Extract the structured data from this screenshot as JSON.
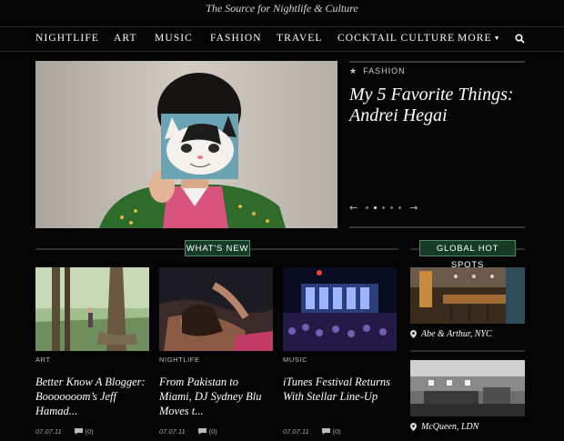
{
  "header": {
    "tagline": "The Source for Nightlife & Culture"
  },
  "nav": {
    "items": [
      "NIGHTLIFE",
      "ART",
      "MUSIC",
      "FASHION",
      "TRAVEL",
      "COCKTAIL CULTURE",
      "MORE"
    ],
    "search_icon": "search-icon"
  },
  "hero": {
    "category": "FASHION",
    "star": "★",
    "title": "My 5 Favorite Things: Andrei Hegai",
    "prev_arrow": "←",
    "next_arrow": "→",
    "slide_count": 5,
    "active_slide": 1
  },
  "sections": {
    "whats_new": "WHAT'S NEW",
    "hot_spots": "GLOBAL HOT SPOTS"
  },
  "articles": [
    {
      "category": "ART",
      "title": "Better Know A Blogger: Booooooom’s Jeff Hamad...",
      "date": "07.07.11",
      "comments": "(0)"
    },
    {
      "category": "NIGHTLIFE",
      "title": "From Pakistan to Miami, DJ Sydney Blu Moves t...",
      "date": "07.07.11",
      "comments": "(0)"
    },
    {
      "category": "MUSIC",
      "title": "iTunes Festival Returns With Stellar Line-Up",
      "date": "07.07.11",
      "comments": "(0)"
    }
  ],
  "hot_spots": [
    {
      "label": "Abe & Arthur, NYC"
    },
    {
      "label": "McQueen, LDN"
    }
  ],
  "colors": {
    "background": "#050505",
    "badge_bg": "#163b26",
    "badge_border": "#4e8b63"
  }
}
